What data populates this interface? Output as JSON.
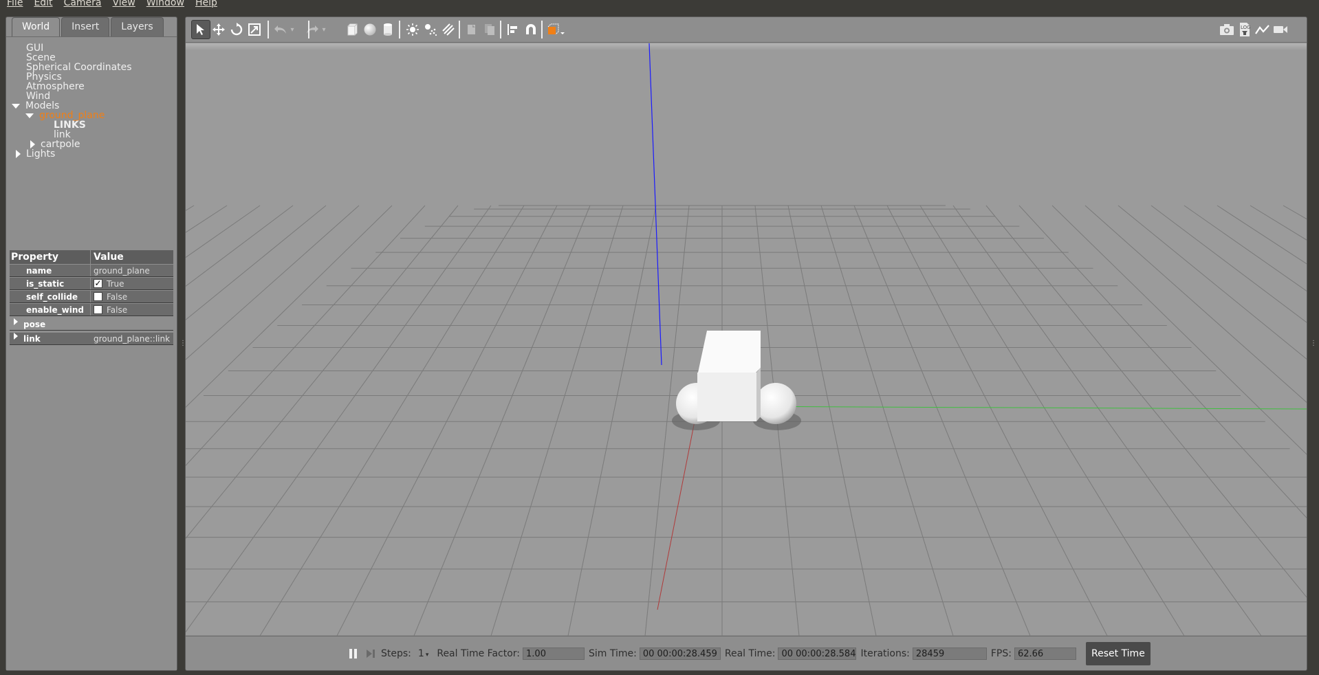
{
  "menubar": {
    "items": [
      "File",
      "Edit",
      "Camera",
      "View",
      "Window",
      "Help"
    ]
  },
  "left_panel": {
    "tabs": [
      "World",
      "Insert",
      "Layers"
    ],
    "active_tab": "World",
    "tree": {
      "gui": "GUI",
      "scene": "Scene",
      "spherical": "Spherical Coordinates",
      "physics": "Physics",
      "atmosphere": "Atmosphere",
      "wind": "Wind",
      "models": "Models",
      "ground_plane": "ground_plane",
      "links": "LINKS",
      "link": "link",
      "cartpole": "cartpole",
      "lights": "Lights"
    },
    "properties": {
      "header_property": "Property",
      "header_value": "Value",
      "rows": [
        {
          "name": "name",
          "value": "ground_plane"
        },
        {
          "name": "is_static",
          "value": "True",
          "checked": true
        },
        {
          "name": "self_collide",
          "value": "False",
          "checked": false
        },
        {
          "name": "enable_wind",
          "value": "False",
          "checked": false
        }
      ],
      "pose_label": "pose",
      "link_label": "link",
      "link_value": "ground_plane::link"
    }
  },
  "toolbar": {
    "icons": [
      "select-arrow-icon",
      "translate-icon",
      "rotate-icon",
      "scale-icon",
      "undo-icon",
      "redo-icon",
      "box-icon",
      "sphere-icon",
      "cylinder-icon",
      "point-light-icon",
      "spot-light-icon",
      "directional-light-icon",
      "copy-icon",
      "paste-icon",
      "align-icon",
      "snap-magnet-icon",
      "view-angle-icon",
      "screenshot-icon",
      "log-icon",
      "plot-icon",
      "record-video-icon"
    ]
  },
  "statusbar": {
    "steps_label": "Steps:",
    "steps_value": "1",
    "rtf_label": "Real Time Factor:",
    "rtf_value": "1.00",
    "sim_time_label": "Sim Time:",
    "sim_time_value": "00 00:00:28.459",
    "real_time_label": "Real Time:",
    "real_time_value": "00 00:00:28.584",
    "iterations_label": "Iterations:",
    "iterations_value": "28459",
    "fps_label": "FPS:",
    "fps_value": "62.66",
    "reset_label": "Reset Time"
  },
  "colors": {
    "selected_tree": "#f07f16",
    "panel_bg": "#8e8e8e",
    "axis_z": "#1a1aff",
    "axis_x": "#d02020",
    "axis_y": "#20c020"
  }
}
